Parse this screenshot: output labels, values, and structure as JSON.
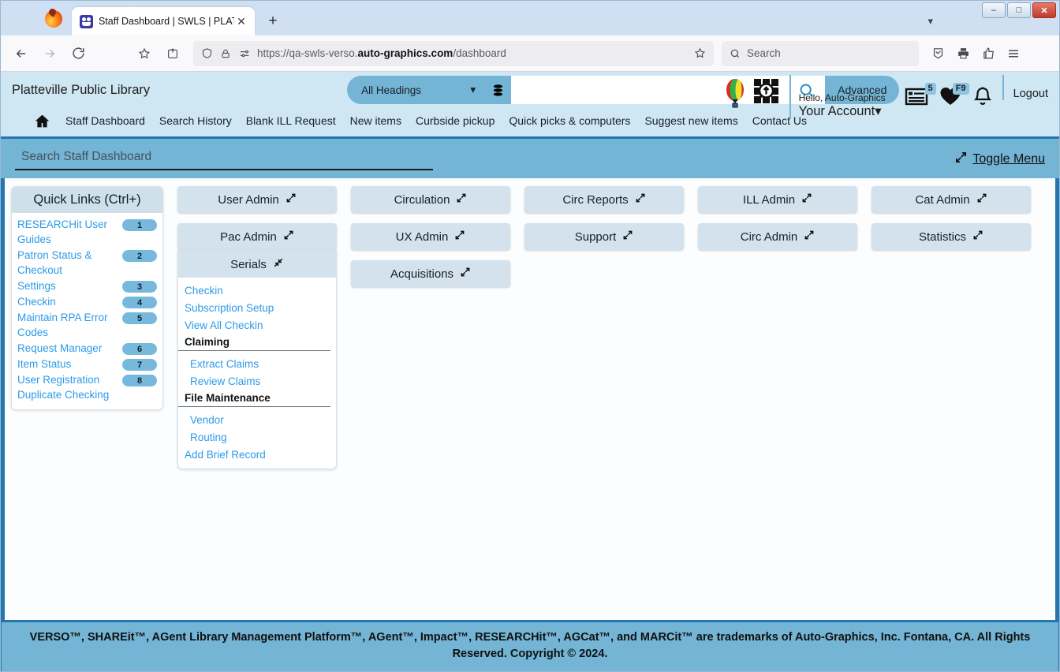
{
  "browser": {
    "tab_title": "Staff Dashboard | SWLS | PLATT",
    "tab_favicon": "verso-favicon",
    "new_tab_label": "+",
    "close_tab_label": "✕",
    "url_prefix": "https://qa-swls-verso.",
    "url_domain": "auto-graphics.com",
    "url_suffix": "/dashboard",
    "search_placeholder": "Search",
    "window_minimize": "–",
    "window_maximize": "□",
    "window_close": "✕"
  },
  "header": {
    "library_name": "Platteville Public Library",
    "search_scope": "All Headings",
    "search_value": "",
    "search_placeholder": "",
    "advanced_label": "Advanced",
    "hello_text": "Hello, Auto-Graphics",
    "account_label": "Your Account",
    "logout_label": "Logout",
    "list_badge": "5",
    "favorites_badge": "F9"
  },
  "nav": {
    "items": [
      "Staff Dashboard",
      "Search History",
      "Blank ILL Request",
      "New items",
      "Curbside pickup",
      "Quick picks & computers",
      "Suggest new items",
      "Contact Us"
    ]
  },
  "search_strip": {
    "placeholder": "Search Staff Dashboard",
    "value": "",
    "toggle_menu_label": "Toggle Menu"
  },
  "quick_links": {
    "title": "Quick Links (Ctrl+)",
    "items": [
      {
        "label": "RESEARCHit User Guides",
        "badge": "1"
      },
      {
        "label": "Patron Status & Checkout",
        "badge": "2"
      },
      {
        "label": "Settings",
        "badge": "3"
      },
      {
        "label": "Checkin",
        "badge": "4"
      },
      {
        "label": "Maintain RPA Error Codes",
        "badge": "5"
      },
      {
        "label": "Request Manager",
        "badge": "6"
      },
      {
        "label": "Item Status",
        "badge": "7"
      },
      {
        "label": "User Registration Duplicate Checking",
        "badge": "8"
      }
    ]
  },
  "dashboard": {
    "columns": [
      {
        "buttons": [
          "User Admin",
          "Pac Admin",
          "Serials"
        ]
      },
      {
        "buttons": [
          "Circulation",
          "UX Admin",
          "Acquisitions"
        ]
      },
      {
        "buttons": [
          "Circ Reports",
          "Support"
        ]
      },
      {
        "buttons": [
          "ILL Admin",
          "Circ Admin"
        ]
      },
      {
        "buttons": [
          "Cat Admin",
          "Statistics"
        ]
      }
    ],
    "serials_menu": {
      "title": "Serials",
      "groups": [
        {
          "links": [
            "Checkin",
            "Subscription Setup",
            "View All Checkin"
          ]
        },
        {
          "heading": "Claiming",
          "links": [
            "Extract Claims",
            "Review Claims"
          ]
        },
        {
          "heading": "File Maintenance",
          "links": [
            "Vendor",
            "Routing"
          ]
        },
        {
          "links": [
            "Add Brief Record"
          ]
        }
      ]
    }
  },
  "footer": {
    "line1": "VERSO™, SHAREit™, AGent Library Management Platform™, AGent™, Impact™, RESEARCHit™, AGCat™, and MARCit™ are trademarks of Auto-Graphics, Inc. Fontana, CA. All",
    "line2": "Rights Reserved. Copyright © 2024."
  },
  "colors": {
    "accent_blue": "#2277b0",
    "header_bg": "#cfe7f3",
    "strip_bg": "#74b4d4",
    "button_bg": "#d3e2ec",
    "link_blue": "#2e9ae8"
  }
}
